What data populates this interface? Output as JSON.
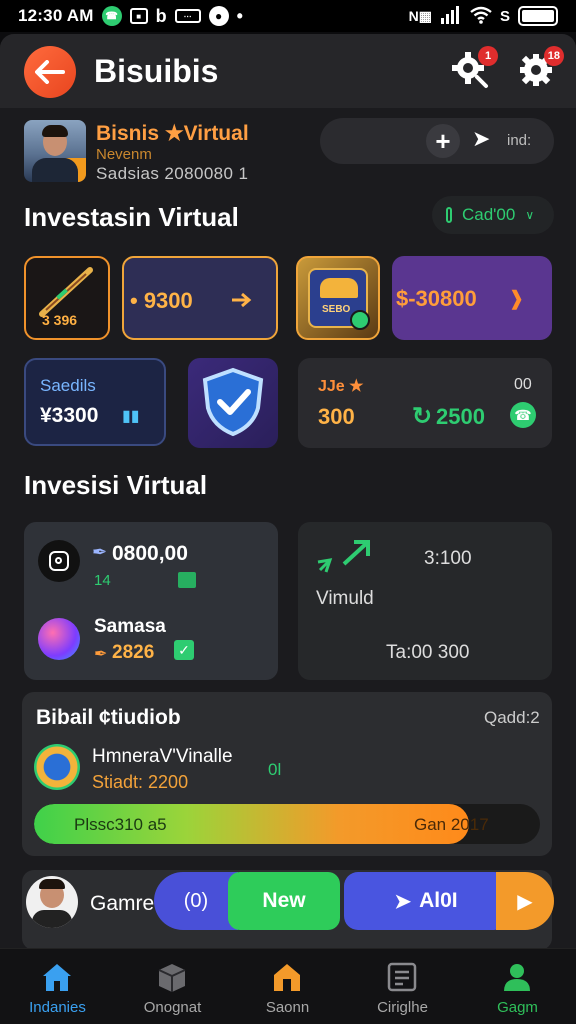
{
  "status_bar": {
    "time": "12:30 AM",
    "badges": [
      "●",
      "▣",
      "b",
      "▬",
      "●",
      "•"
    ],
    "right": [
      "▣",
      "▣",
      "☷",
      "⚙"
    ]
  },
  "header": {
    "title": "Bisuibis",
    "back_icon": "←",
    "settings_badge_1": "1",
    "settings_badge_2": "18"
  },
  "profile": {
    "name": "Bisnis ★Virtual",
    "subtitle": "Nevenm",
    "stats": "Sadsias 2080080  1",
    "pill_plus": "+",
    "pill_share": "➤",
    "pill_text": "ind:"
  },
  "section1": {
    "title": "Investasin Virtual",
    "select_label": "Cad'00",
    "select_chevron": "∨"
  },
  "cards_row1": {
    "card1_value": "3 396",
    "card2_value": "• 9300",
    "card3_text": "SEBO",
    "card4_value": "$-30800"
  },
  "cards_row2": {
    "card1_label": "Saedils",
    "card1_value": "¥3300",
    "card2_icon": "shield-check",
    "card3_label": "JJe ★",
    "card3_right": "00",
    "card3_value": "300",
    "card3_value2": "2500"
  },
  "section2": {
    "title": "Invesisi Virtual",
    "left_value": "0800,00",
    "left_sub": "14",
    "left_name": "Samasa",
    "left_value2": "2826",
    "right_top": "3:100",
    "right_label": "Vimuld",
    "right_bottom": "Ta:00 300"
  },
  "section3": {
    "title": "Bibail ¢tiudiob",
    "right": "Qadd:2",
    "item_name": "HmneraV'Vinalle",
    "item_stat": "Stiadt: 2200",
    "item_right": "0l",
    "progress_label": "Plssc310 a5",
    "progress_right": "Gan 2017",
    "progress_value": 0.86
  },
  "section4": {
    "label": "Gamre",
    "btn1": "(0)",
    "btn2": "New",
    "btn3": "Al0I",
    "btn4": "▶"
  },
  "bottom_nav": [
    {
      "label": "Indanies",
      "color": "#3aa0f0"
    },
    {
      "label": "Onognat",
      "color": "#a8a8a8"
    },
    {
      "label": "Saonn",
      "color": "#a8a8a8"
    },
    {
      "label": "Ciriglhe",
      "color": "#a8a8a8"
    },
    {
      "label": "Gagm",
      "color": "#2fbf5a"
    }
  ]
}
